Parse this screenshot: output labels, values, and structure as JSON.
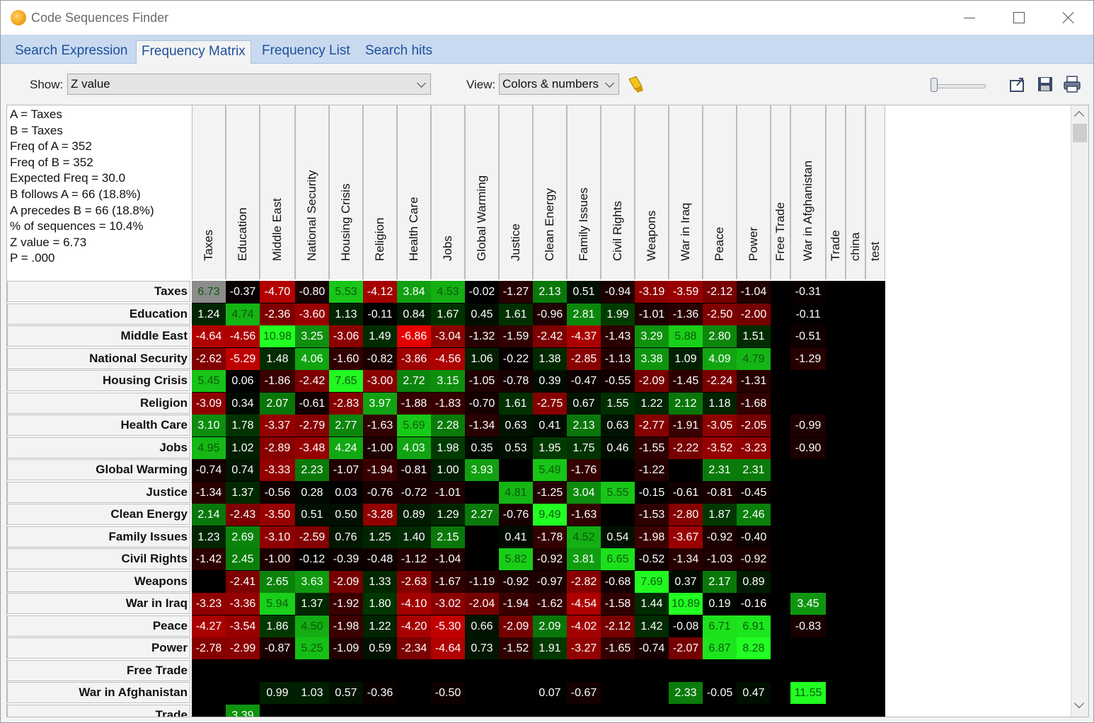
{
  "window": {
    "title": "Code Sequences Finder"
  },
  "tabs": [
    {
      "label": "Search Expression",
      "active": false
    },
    {
      "label": "Frequency Matrix",
      "active": true
    },
    {
      "label": "Frequency List",
      "active": false
    },
    {
      "label": "Search hits",
      "active": false
    }
  ],
  "toolbar": {
    "show_label": "Show:",
    "show_value": "Z value",
    "view_label": "View:",
    "view_value": "Colors & numbers",
    "icons": [
      "highlighter-icon",
      "export-icon",
      "save-icon",
      "print-icon"
    ]
  },
  "info": [
    "A = Taxes",
    "B = Taxes",
    "Freq of A = 352",
    "Freq of B = 352",
    "Expected Freq = 30.0",
    "B follows A = 66 (18.8%)",
    "A precedes B = 66 (18.8%)",
    "% of sequences = 10.4%",
    "Z value = 6.73",
    "P = .000"
  ],
  "columns": [
    "Taxes",
    "Education",
    "Middle East",
    "National Security",
    "Housing Crisis",
    "Religion",
    "Health Care",
    "Jobs",
    "Global Warming",
    "Justice",
    "Clean Energy",
    "Family Issues",
    "Civil Rights",
    "Weapons",
    "War in Iraq",
    "Peace",
    "Power",
    "Free Trade",
    "War in Afghanistan",
    "Trade",
    "china",
    "test"
  ],
  "rows": [
    {
      "label": "Taxes",
      "values": [
        "6.73",
        "-0.37",
        "-4.70",
        "-0.80",
        "5.53",
        "-4.12",
        "3.84",
        "4.53",
        "-0.02",
        "-1.27",
        "2.13",
        "0.51",
        "-0.94",
        "-3.19",
        "-3.59",
        "-2.12",
        "-1.04",
        "",
        "-0.31",
        "",
        "",
        ""
      ]
    },
    {
      "label": "Education",
      "values": [
        "1.24",
        "4.74",
        "-2.36",
        "-3.60",
        "1.13",
        "-0.11",
        "0.84",
        "1.67",
        "0.45",
        "1.61",
        "-0.96",
        "2.81",
        "1.99",
        "-1.01",
        "-1.36",
        "-2.50",
        "-2.00",
        "",
        "-0.11",
        "",
        "",
        ""
      ]
    },
    {
      "label": "Middle East",
      "values": [
        "-4.64",
        "-4.56",
        "10.98",
        "3.25",
        "-3.06",
        "1.49",
        "-6.86",
        "-3.04",
        "-1.32",
        "-1.59",
        "-2.42",
        "-4.37",
        "-1.43",
        "3.29",
        "5.88",
        "2.80",
        "1.51",
        "",
        "-0.51",
        "",
        "",
        ""
      ]
    },
    {
      "label": "National Security",
      "values": [
        "-2.62",
        "-5.29",
        "1.48",
        "4.06",
        "-1.60",
        "-0.82",
        "-3.86",
        "-4.56",
        "1.06",
        "-0.22",
        "1.38",
        "-2.85",
        "-1.13",
        "3.38",
        "1.09",
        "4.09",
        "4.79",
        "",
        "-1.29",
        "",
        "",
        ""
      ]
    },
    {
      "label": "Housing Crisis",
      "values": [
        "5.45",
        "0.06",
        "-1.86",
        "-2.42",
        "7.65",
        "-3.00",
        "2.72",
        "3.15",
        "-1.05",
        "-0.78",
        "0.39",
        "-0.47",
        "-0.55",
        "-2.09",
        "-1.45",
        "-2.24",
        "-1.31",
        "",
        "",
        "",
        "",
        ""
      ]
    },
    {
      "label": "Religion",
      "values": [
        "-3.09",
        "0.34",
        "2.07",
        "-0.61",
        "-2.83",
        "3.97",
        "-1.88",
        "-1.83",
        "-0.70",
        "1.61",
        "-2.75",
        "0.67",
        "1.55",
        "1.22",
        "2.12",
        "1.18",
        "-1.68",
        "",
        "",
        "",
        "",
        ""
      ]
    },
    {
      "label": "Health Care",
      "values": [
        "3.10",
        "1.78",
        "-3.37",
        "-2.79",
        "2.77",
        "-1.63",
        "5.69",
        "2.28",
        "-1.34",
        "0.63",
        "0.41",
        "2.13",
        "0.63",
        "-2.77",
        "-1.91",
        "-3.05",
        "-2.05",
        "",
        "-0.99",
        "",
        "",
        ""
      ]
    },
    {
      "label": "Jobs",
      "values": [
        "4.95",
        "1.02",
        "-2.89",
        "-3.48",
        "4.24",
        "-1.00",
        "4.03",
        "1.98",
        "0.35",
        "0.53",
        "1.95",
        "1.75",
        "0.46",
        "-1.55",
        "-2.22",
        "-3.52",
        "-3.23",
        "",
        "-0.90",
        "",
        "",
        ""
      ]
    },
    {
      "label": "Global Warming",
      "values": [
        "-0.74",
        "0.74",
        "-3.33",
        "2.23",
        "-1.07",
        "-1.94",
        "-0.81",
        "1.00",
        "3.93",
        "",
        "5.49",
        "-1.76",
        "",
        "-1.22",
        "",
        "2.31",
        "2.31",
        "",
        "",
        "",
        "",
        ""
      ]
    },
    {
      "label": "Justice",
      "values": [
        "-1.34",
        "1.37",
        "-0.56",
        "0.28",
        "0.03",
        "-0.76",
        "-0.72",
        "-1.01",
        "",
        "4.81",
        "-1.25",
        "3.04",
        "5.55",
        "-0.15",
        "-0.61",
        "-0.81",
        "-0.45",
        "",
        "",
        "",
        "",
        ""
      ]
    },
    {
      "label": "Clean Energy",
      "values": [
        "2.14",
        "-2.43",
        "-3.50",
        "0.51",
        "0.50",
        "-3.28",
        "0.89",
        "1.29",
        "2.27",
        "-0.76",
        "9.49",
        "-1.63",
        "",
        "-1.53",
        "-2.80",
        "1.87",
        "2.46",
        "",
        "",
        "",
        "",
        ""
      ]
    },
    {
      "label": "Family Issues",
      "values": [
        "1.23",
        "2.69",
        "-3.10",
        "-2.59",
        "0.76",
        "1.25",
        "1.40",
        "2.15",
        "",
        "0.41",
        "-1.78",
        "4.52",
        "0.54",
        "-1.98",
        "-3.67",
        "-0.92",
        "-0.40",
        "",
        "",
        "",
        "",
        ""
      ]
    },
    {
      "label": "Civil Rights",
      "values": [
        "-1.42",
        "2.45",
        "-1.00",
        "-0.12",
        "-0.39",
        "-0.48",
        "-1.12",
        "-1.04",
        "",
        "5.82",
        "-0.92",
        "3.81",
        "6.65",
        "-0.52",
        "-1.34",
        "-1.03",
        "-0.92",
        "",
        "",
        "",
        "",
        ""
      ]
    },
    {
      "label": "Weapons",
      "values": [
        "",
        "-2.41",
        "2.65",
        "3.63",
        "-2.09",
        "1.33",
        "-2.63",
        "-1.67",
        "-1.19",
        "-0.92",
        "-0.97",
        "-2.82",
        "-0.68",
        "7.69",
        "0.37",
        "2.17",
        "0.89",
        "",
        "",
        "",
        "",
        ""
      ]
    },
    {
      "label": "War in Iraq",
      "values": [
        "-3.23",
        "-3.36",
        "5.94",
        "1.37",
        "-1.92",
        "1.80",
        "-4.10",
        "-3.02",
        "-2.04",
        "-1.94",
        "-1.62",
        "-4.54",
        "-1.58",
        "1.44",
        "10.89",
        "0.19",
        "-0.16",
        "",
        "3.45",
        "",
        "",
        ""
      ]
    },
    {
      "label": "Peace",
      "values": [
        "-4.27",
        "-3.54",
        "1.86",
        "4.50",
        "-1.98",
        "1.22",
        "-4.20",
        "-5.30",
        "0.66",
        "-2.09",
        "2.09",
        "-4.02",
        "-2.12",
        "1.42",
        "-0.08",
        "6.71",
        "6.91",
        "",
        "-0.83",
        "",
        "",
        ""
      ]
    },
    {
      "label": "Power",
      "values": [
        "-2.78",
        "-2.99",
        "-0.87",
        "5.25",
        "-1.09",
        "0.59",
        "-2.34",
        "-4.64",
        "0.73",
        "-1.52",
        "1.91",
        "-3.27",
        "-1.65",
        "-0.74",
        "-2.07",
        "6.87",
        "8.28",
        "",
        "",
        "",
        "",
        ""
      ]
    },
    {
      "label": "Free Trade",
      "values": [
        "",
        "",
        "",
        "",
        "",
        "",
        "",
        "",
        "",
        "",
        "",
        "",
        "",
        "",
        "",
        "",
        "",
        "",
        "",
        "",
        "",
        ""
      ]
    },
    {
      "label": "War in Afghanistan",
      "values": [
        "",
        "",
        "0.99",
        "1.03",
        "0.57",
        "-0.36",
        "",
        "-0.50",
        "",
        "",
        "0.07",
        "-0.67",
        "",
        "",
        "2.33",
        "-0.05",
        "0.47",
        "",
        "11.55",
        "",
        "",
        ""
      ]
    },
    {
      "label": "Trade",
      "values": [
        "",
        "3.39",
        "",
        "",
        "",
        "",
        "",
        "",
        "",
        "",
        "",
        "",
        "",
        "",
        "",
        "",
        "",
        "",
        "",
        "",
        "",
        ""
      ]
    }
  ],
  "colors": {
    "selected": "#8c8c8c",
    "positive_max": "#22ff22",
    "negative_max": "#e00000",
    "neutral": "#000000",
    "tab_strip": "#c9daf0",
    "tab_text": "#1f4f9a"
  }
}
